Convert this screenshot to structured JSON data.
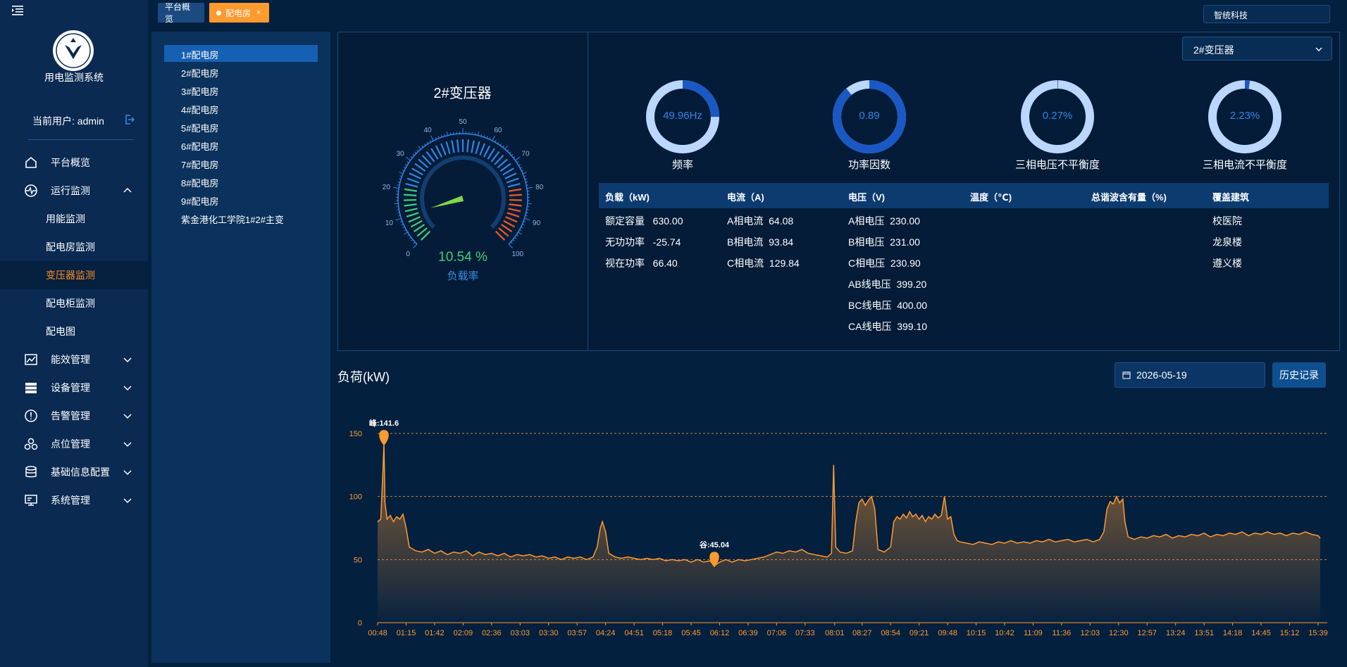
{
  "app": {
    "system_title": "用电监测系统",
    "user_label": "当前用户: admin",
    "company": "智统科技"
  },
  "sidebar": {
    "menu": [
      {
        "label": "平台概览",
        "icon": "home-icon",
        "expandable": false
      },
      {
        "label": "运行监测",
        "icon": "monitor-icon",
        "expandable": true,
        "expanded": true
      },
      {
        "label": "能效管理",
        "icon": "efficiency-icon",
        "expandable": true
      },
      {
        "label": "设备管理",
        "icon": "device-icon",
        "expandable": true
      },
      {
        "label": "告警管理",
        "icon": "alarm-icon",
        "expandable": true
      },
      {
        "label": "点位管理",
        "icon": "point-icon",
        "expandable": true
      },
      {
        "label": "基础信息配置",
        "icon": "database-icon",
        "expandable": true
      },
      {
        "label": "系统管理",
        "icon": "system-icon",
        "expandable": true
      }
    ],
    "submenu": [
      {
        "label": "用能监测",
        "active": false
      },
      {
        "label": "配电房监测",
        "active": false
      },
      {
        "label": "变压器监测",
        "active": true
      },
      {
        "label": "配电柜监测",
        "active": false
      },
      {
        "label": "配电图",
        "active": false
      }
    ]
  },
  "tabs": [
    {
      "label": "平台概览"
    },
    {
      "label": "配电房",
      "active": true,
      "close": "×"
    }
  ],
  "rooms": [
    "1#配电房",
    "2#配电房",
    "3#配电房",
    "4#配电房",
    "5#配电房",
    "6#配电房",
    "7#配电房",
    "8#配电房",
    "9#配电房",
    "紫金港化工学院1#2#主变"
  ],
  "transformer": {
    "select_value": "2#变压器",
    "title": "2#变压器",
    "load_rate_value": "10.54 %",
    "load_rate_label": "负载率",
    "load_rate": 10.54,
    "gauge_ticks": [
      "0",
      "10",
      "20",
      "30",
      "40",
      "50",
      "60",
      "70",
      "80",
      "90",
      "100"
    ]
  },
  "metrics": [
    {
      "value": "49.96Hz",
      "label": "频率",
      "fraction": 0.25
    },
    {
      "value": "0.89",
      "label": "功率因数",
      "fraction": 0.89
    },
    {
      "value": "0.27%",
      "label": "三相电压不平衡度",
      "fraction": 0.0027
    },
    {
      "value": "2.23%",
      "label": "三相电流不平衡度",
      "fraction": 0.0223
    }
  ],
  "table": {
    "headers": [
      "负载（kW)",
      "电流（A)",
      "电压（V)",
      "温度（℃)",
      "总谐波含有量（%)",
      "覆盖建筑"
    ],
    "load": [
      "额定容量   630.00",
      "无功功率   -25.74",
      "视在功率   66.40"
    ],
    "current": [
      "A相电流  64.08",
      "B相电流  93.84",
      "C相电流  129.84"
    ],
    "voltage": [
      "A相电压  230.00",
      "B相电压  231.00",
      "C相电压  230.90",
      "AB线电压  399.20",
      "BC线电压  400.00",
      "CA线电压  399.10"
    ],
    "buildings": [
      "校医院",
      "龙泉楼",
      "遵义楼"
    ]
  },
  "chart_controls": {
    "title": "负荷(kW)",
    "date": "2026-05-19",
    "history_button": "历史记录"
  },
  "chart_data": {
    "type": "area",
    "title": "负荷(kW)",
    "ylim": [
      0,
      150
    ],
    "y_ticks": [
      0,
      50,
      100,
      150
    ],
    "x_ticks": [
      "00:48",
      "01:15",
      "01:42",
      "02:09",
      "02:36",
      "03:03",
      "03:30",
      "03:57",
      "04:24",
      "04:51",
      "05:18",
      "05:45",
      "06:12",
      "06:39",
      "07:06",
      "07:33",
      "08:01",
      "08:27",
      "08:54",
      "09:21",
      "09:48",
      "10:15",
      "10:42",
      "11:09",
      "11:36",
      "12:03",
      "12:30",
      "12:57",
      "13:24",
      "13:51",
      "14:18",
      "14:45",
      "15:12",
      "15:39"
    ],
    "x_range": [
      "00:48",
      "15:41"
    ],
    "grid": "dashed horizontal at 50, 100, 150",
    "annotations": [
      {
        "label": "峰:141.6",
        "time": "00:54",
        "value": 141.6
      },
      {
        "label": "谷:45.04",
        "time": "06:07",
        "value": 45.04
      }
    ],
    "series": [
      {
        "points": [
          [
            "00:48",
            80
          ],
          [
            "00:51",
            82
          ],
          [
            "00:53",
            120
          ],
          [
            "00:54",
            141.6
          ],
          [
            "00:55",
            95
          ],
          [
            "00:57",
            82
          ],
          [
            "01:00",
            85
          ],
          [
            "01:03",
            80
          ],
          [
            "01:06",
            84
          ],
          [
            "01:09",
            82
          ],
          [
            "01:12",
            86
          ],
          [
            "01:15",
            75
          ],
          [
            "01:18",
            60
          ],
          [
            "01:24",
            57
          ],
          [
            "01:30",
            56
          ],
          [
            "01:36",
            58
          ],
          [
            "01:42",
            55
          ],
          [
            "01:48",
            57
          ],
          [
            "01:54",
            54
          ],
          [
            "02:00",
            56
          ],
          [
            "02:06",
            55
          ],
          [
            "02:12",
            57
          ],
          [
            "02:18",
            53
          ],
          [
            "02:24",
            56
          ],
          [
            "02:30",
            54
          ],
          [
            "02:36",
            55
          ],
          [
            "02:42",
            53
          ],
          [
            "02:48",
            55
          ],
          [
            "02:54",
            52
          ],
          [
            "03:00",
            54
          ],
          [
            "03:06",
            53
          ],
          [
            "03:12",
            54
          ],
          [
            "03:18",
            52
          ],
          [
            "03:24",
            53
          ],
          [
            "03:30",
            51
          ],
          [
            "03:36",
            52
          ],
          [
            "03:42",
            50
          ],
          [
            "03:48",
            52
          ],
          [
            "03:54",
            51
          ],
          [
            "04:00",
            52
          ],
          [
            "04:06",
            50
          ],
          [
            "04:12",
            52
          ],
          [
            "04:16",
            60
          ],
          [
            "04:19",
            75
          ],
          [
            "04:21",
            80
          ],
          [
            "04:24",
            72
          ],
          [
            "04:27",
            55
          ],
          [
            "04:33",
            52
          ],
          [
            "04:39",
            51
          ],
          [
            "04:45",
            52
          ],
          [
            "04:51",
            51
          ],
          [
            "04:57",
            50
          ],
          [
            "05:03",
            51
          ],
          [
            "05:09",
            50
          ],
          [
            "05:15",
            51
          ],
          [
            "05:21",
            49
          ],
          [
            "05:27",
            50
          ],
          [
            "05:33",
            49
          ],
          [
            "05:39",
            50
          ],
          [
            "05:45",
            48
          ],
          [
            "05:51",
            50
          ],
          [
            "05:57",
            48
          ],
          [
            "06:03",
            49
          ],
          [
            "06:07",
            45.04
          ],
          [
            "06:12",
            48
          ],
          [
            "06:18",
            50
          ],
          [
            "06:24",
            48
          ],
          [
            "06:30",
            50
          ],
          [
            "06:36",
            49
          ],
          [
            "06:42",
            50
          ],
          [
            "06:48",
            51
          ],
          [
            "06:54",
            52
          ],
          [
            "07:00",
            54
          ],
          [
            "07:06",
            56
          ],
          [
            "07:12",
            55
          ],
          [
            "07:18",
            57
          ],
          [
            "07:24",
            56
          ],
          [
            "07:30",
            58
          ],
          [
            "07:36",
            55
          ],
          [
            "07:42",
            54
          ],
          [
            "07:48",
            53
          ],
          [
            "07:54",
            52
          ],
          [
            "07:58",
            55
          ],
          [
            "08:00",
            125
          ],
          [
            "08:02",
            60
          ],
          [
            "08:06",
            56
          ],
          [
            "08:12",
            55
          ],
          [
            "08:18",
            57
          ],
          [
            "08:21",
            80
          ],
          [
            "08:24",
            95
          ],
          [
            "08:27",
            98
          ],
          [
            "08:30",
            93
          ],
          [
            "08:33",
            97
          ],
          [
            "08:36",
            100
          ],
          [
            "08:39",
            90
          ],
          [
            "08:42",
            58
          ],
          [
            "08:48",
            56
          ],
          [
            "08:54",
            60
          ],
          [
            "08:57",
            80
          ],
          [
            "09:00",
            84
          ],
          [
            "09:03",
            82
          ],
          [
            "09:06",
            86
          ],
          [
            "09:09",
            83
          ],
          [
            "09:12",
            88
          ],
          [
            "09:15",
            84
          ],
          [
            "09:18",
            86
          ],
          [
            "09:21",
            82
          ],
          [
            "09:24",
            85
          ],
          [
            "09:27",
            80
          ],
          [
            "09:30",
            84
          ],
          [
            "09:33",
            82
          ],
          [
            "09:36",
            86
          ],
          [
            "09:39",
            83
          ],
          [
            "09:42",
            85
          ],
          [
            "09:45",
            100
          ],
          [
            "09:48",
            82
          ],
          [
            "09:51",
            84
          ],
          [
            "09:54",
            70
          ],
          [
            "09:57",
            65
          ],
          [
            "10:00",
            64
          ],
          [
            "10:06",
            63
          ],
          [
            "10:12",
            62
          ],
          [
            "10:18",
            64
          ],
          [
            "10:24",
            63
          ],
          [
            "10:30",
            62
          ],
          [
            "10:36",
            64
          ],
          [
            "10:42",
            63
          ],
          [
            "10:48",
            65
          ],
          [
            "10:54",
            63
          ],
          [
            "11:00",
            64
          ],
          [
            "11:06",
            63
          ],
          [
            "11:12",
            65
          ],
          [
            "11:18",
            64
          ],
          [
            "11:24",
            66
          ],
          [
            "11:30",
            64
          ],
          [
            "11:36",
            65
          ],
          [
            "11:42",
            66
          ],
          [
            "11:48",
            64
          ],
          [
            "11:54",
            65
          ],
          [
            "12:00",
            66
          ],
          [
            "12:06",
            64
          ],
          [
            "12:12",
            66
          ],
          [
            "12:16",
            72
          ],
          [
            "12:19",
            90
          ],
          [
            "12:22",
            96
          ],
          [
            "12:25",
            94
          ],
          [
            "12:28",
            100
          ],
          [
            "12:31",
            95
          ],
          [
            "12:34",
            98
          ],
          [
            "12:36",
            80
          ],
          [
            "12:39",
            68
          ],
          [
            "12:45",
            66
          ],
          [
            "12:51",
            68
          ],
          [
            "12:57",
            67
          ],
          [
            "13:03",
            69
          ],
          [
            "13:09",
            68
          ],
          [
            "13:15",
            70
          ],
          [
            "13:21",
            67
          ],
          [
            "13:27",
            69
          ],
          [
            "13:33",
            68
          ],
          [
            "13:39",
            70
          ],
          [
            "13:45",
            69
          ],
          [
            "13:51",
            71
          ],
          [
            "13:57",
            68
          ],
          [
            "14:03",
            70
          ],
          [
            "14:09",
            69
          ],
          [
            "14:15",
            71
          ],
          [
            "14:21",
            70
          ],
          [
            "14:27",
            72
          ],
          [
            "14:33",
            69
          ],
          [
            "14:39",
            71
          ],
          [
            "14:45",
            70
          ],
          [
            "14:51",
            72
          ],
          [
            "14:57",
            70
          ],
          [
            "15:03",
            71
          ],
          [
            "15:09",
            69
          ],
          [
            "15:15",
            71
          ],
          [
            "15:21",
            70
          ],
          [
            "15:27",
            72
          ],
          [
            "15:33",
            70
          ],
          [
            "15:39",
            69
          ],
          [
            "15:41",
            67
          ]
        ]
      }
    ]
  },
  "colors": {
    "accent": "#ff9a2e",
    "gauge_green": "#3fd07a",
    "gauge_blue": "#2f86e6",
    "gauge_red": "#f05a28",
    "donut_fill": "#1a58c6",
    "donut_track": "#bcd7ff",
    "active_menu": "#ff8f1f"
  }
}
